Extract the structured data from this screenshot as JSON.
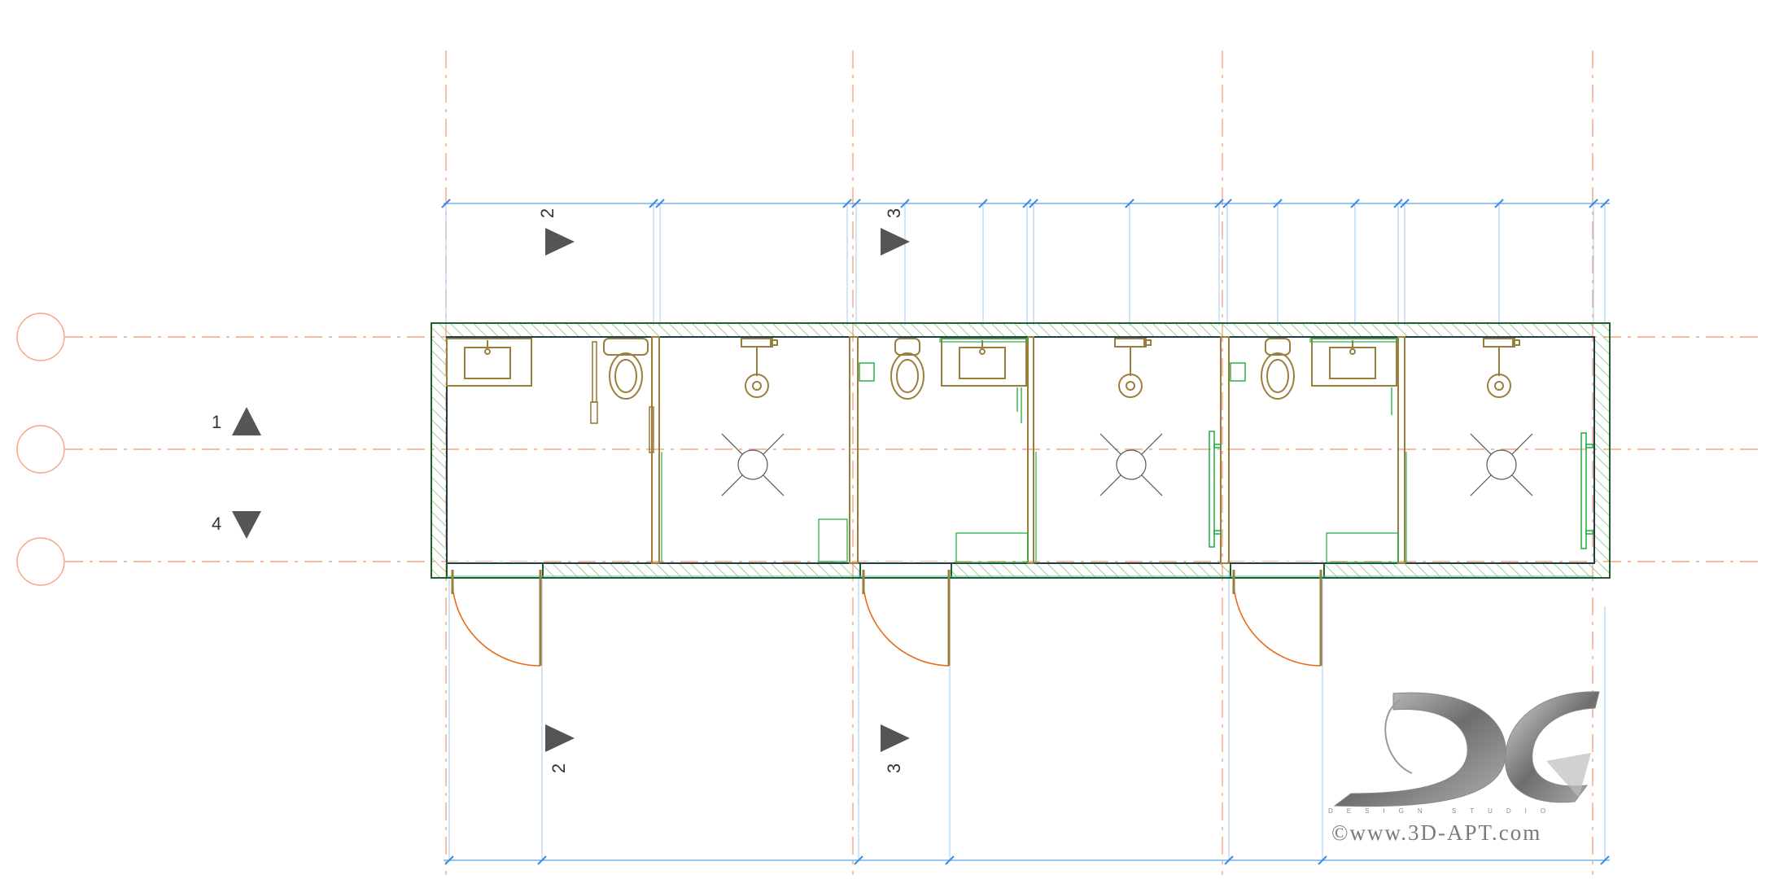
{
  "drawing": {
    "colors": {
      "grid_line": "#f4a582",
      "dimension_line": "#5aa0e6",
      "wall_outline": "#1f5f2a",
      "wall_hatch": "#8cc07a",
      "fixture": "#9a7f3c",
      "door_swing": "#e86a1a",
      "green_detail": "#2bb04a",
      "section_marker": "#555555"
    },
    "units": [
      {
        "name": "unit-1",
        "fixtures": [
          "washbasin-icon",
          "toilet-icon",
          "shower-icon"
        ]
      },
      {
        "name": "unit-2",
        "fixtures": [
          "toilet-icon",
          "washbasin-icon",
          "shower-icon"
        ]
      },
      {
        "name": "unit-3",
        "fixtures": [
          "toilet-icon",
          "washbasin-icon",
          "shower-icon"
        ]
      }
    ],
    "section_marks": {
      "top_left": "2",
      "top_mid": "3",
      "bottom_left": "2",
      "bottom_mid": "3",
      "left_up": "1",
      "left_down": "4"
    }
  },
  "watermark": {
    "text": "©www.3D-APT.com",
    "sub": "DESIGN STUDIO"
  }
}
